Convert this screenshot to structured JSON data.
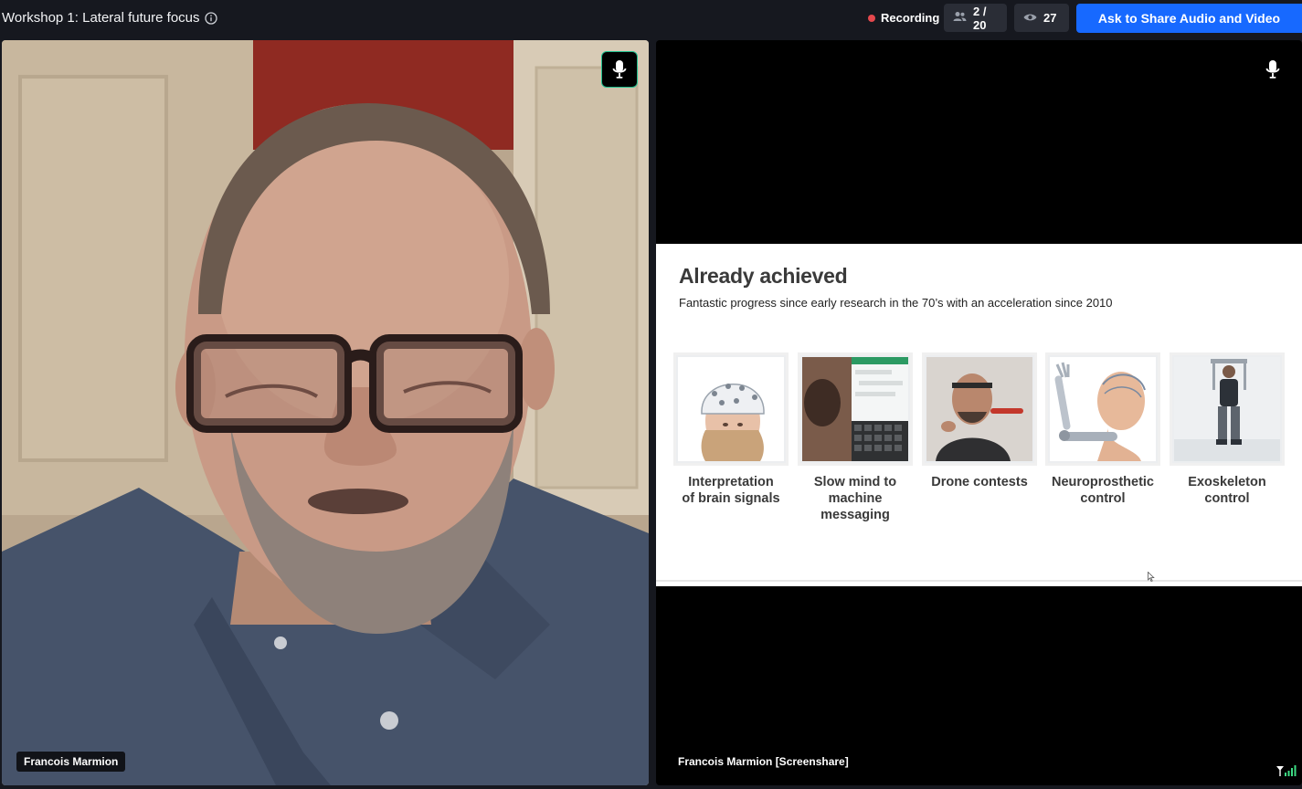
{
  "topbar": {
    "title": "Workshop 1: Lateral future focus",
    "info_icon": "info-icon",
    "recording_label": "Recording",
    "recording_color": "#e5484d",
    "participants_count": "2 / 20",
    "viewers_count": "27",
    "share_button": "Ask to Share Audio and Video",
    "accent_color": "#1769ff"
  },
  "tiles": [
    {
      "name": "Francois Marmion",
      "type": "camera",
      "mic_icon": "microphone-icon",
      "mic_active": true
    },
    {
      "name": "Francois Marmion [Screenshare]",
      "type": "screenshare",
      "mic_icon": "microphone-icon",
      "signal_icon": "signal-strength-icon"
    }
  ],
  "slide": {
    "title": "Already achieved",
    "subtitle": "Fantastic progress since early research in the 70’s with an acceleration since 2010",
    "cards": [
      {
        "label_1": "Interpretation",
        "label_2": "of brain signals",
        "label_3": "",
        "image": "eeg-cap-image"
      },
      {
        "label_1": "Slow mind to",
        "label_2": "machine",
        "label_3": "messaging",
        "image": "tablet-messaging-image"
      },
      {
        "label_1": "Drone contests",
        "label_2": "",
        "label_3": "",
        "image": "drone-headset-image"
      },
      {
        "label_1": "Neuroprosthetic",
        "label_2": "control",
        "label_3": "",
        "image": "prosthetic-arm-image"
      },
      {
        "label_1": "Exoskeleton",
        "label_2": "control",
        "label_3": "",
        "image": "exoskeleton-image"
      }
    ]
  }
}
